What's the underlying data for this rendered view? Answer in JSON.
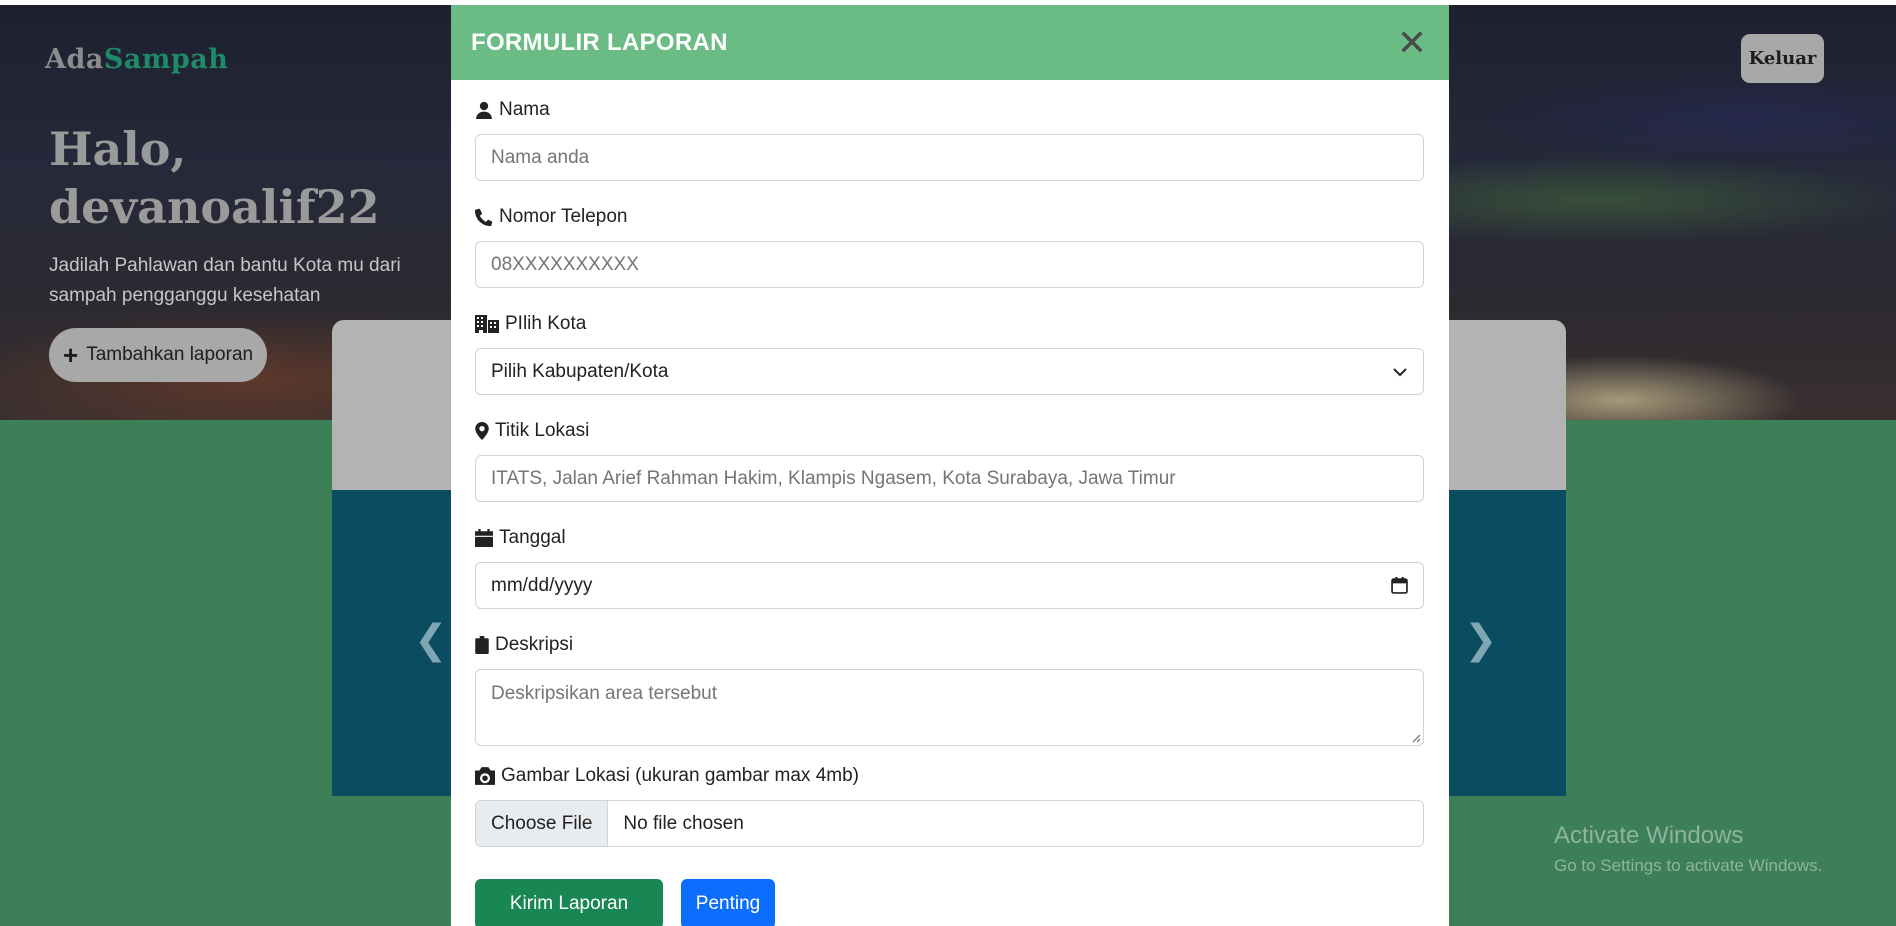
{
  "page": {
    "logo": {
      "part1": "Ada",
      "part2": "Sampah"
    },
    "greeting_line1": "Halo,",
    "greeting_line2": "devanoalif22",
    "tagline": "Jadilah Pahlawan dan bantu Kota mu dari sampah pengganggu kesehatan",
    "add_report_label": "Tambahkan laporan",
    "logout_label": "Keluar",
    "carousel": {
      "prev_icon": "chevron-left-icon",
      "next_icon": "chevron-right-icon"
    }
  },
  "modal": {
    "title": "FORMULIR LAPORAN",
    "close_icon": "close-icon",
    "fields": {
      "name": {
        "label": "Nama",
        "placeholder": "Nama anda",
        "icon": "user-icon"
      },
      "phone": {
        "label": "Nomor Telepon",
        "placeholder": "08XXXXXXXXXX",
        "icon": "phone-icon"
      },
      "city": {
        "label": "PIlih Kota",
        "selected": "Pilih Kabupaten/Kota",
        "icon": "building-icon"
      },
      "location": {
        "label": "Titik Lokasi",
        "placeholder": "ITATS, Jalan Arief Rahman Hakim, Klampis Ngasem, Kota Surabaya, Jawa Timur",
        "icon": "map-marker-icon"
      },
      "date": {
        "label": "Tanggal",
        "placeholder": "mm/dd/yyyy",
        "icon": "calendar-icon"
      },
      "description": {
        "label": "Deskripsi",
        "placeholder": "Deskripsikan area tersebut",
        "icon": "clipboard-icon"
      },
      "image": {
        "label": "Gambar Lokasi (ukuran gambar max 4mb)",
        "choose_label": "Choose File",
        "status": "No file chosen",
        "icon": "camera-icon"
      }
    },
    "buttons": {
      "submit": "Kirim Laporan",
      "important": "Penting"
    }
  },
  "os_watermark": {
    "title": "Activate Windows",
    "subtitle": "Go to Settings to activate Windows."
  },
  "colors": {
    "modal_header": "#6bbb85",
    "brand_green": "#1e8a68",
    "submit_button": "#198754",
    "important_button": "#0d6efd",
    "page_green": "#3d8058",
    "carousel_blue": "#0a4c60"
  }
}
